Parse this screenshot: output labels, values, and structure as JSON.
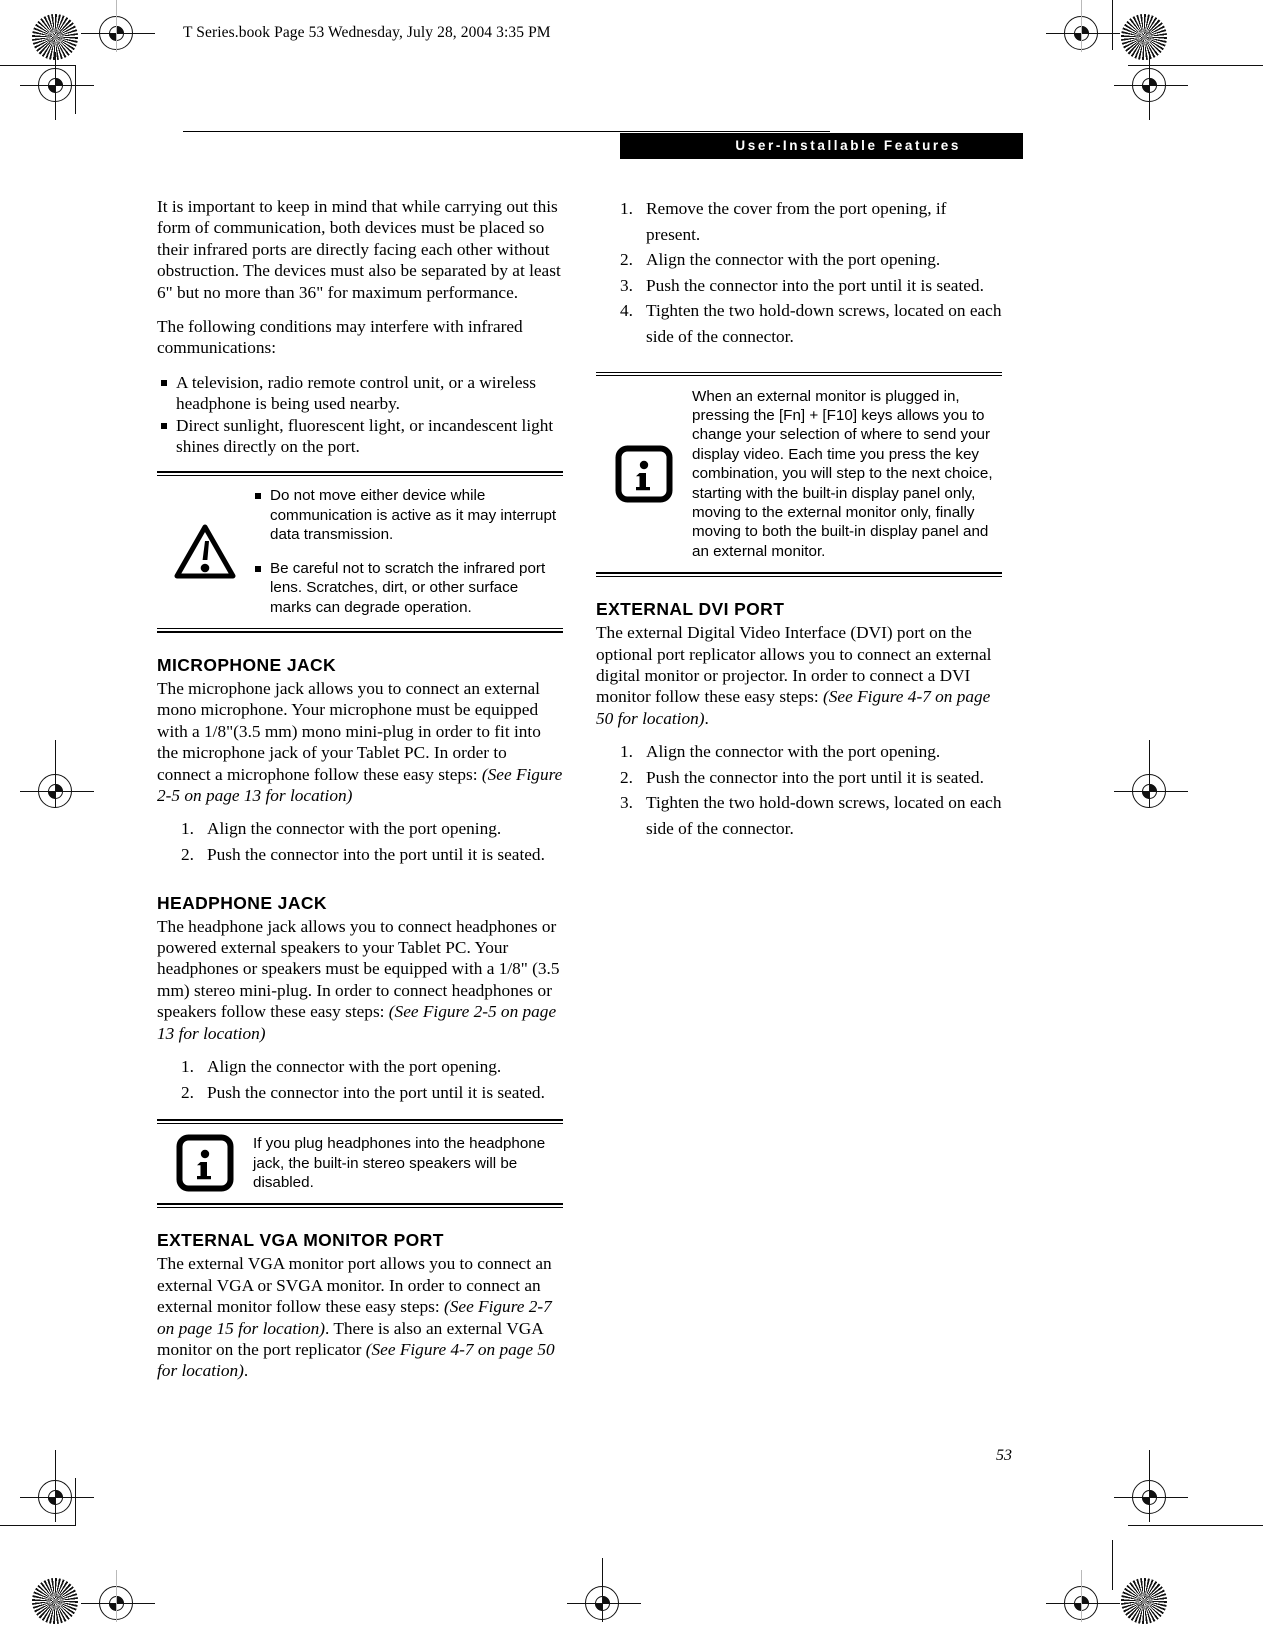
{
  "print_marks": {
    "file_stamp": "T Series.book  Page 53  Wednesday, July 28, 2004  3:35 PM",
    "star_target_name": "star-target",
    "registration_name": "registration-mark"
  },
  "header": {
    "title": "User-Installable Features"
  },
  "page": {
    "number": "53"
  },
  "left_column": {
    "intro_paragraph": "It is important to keep in mind that while carrying out this form of communication, both devices must be placed so their infrared ports are directly facing each other without obstruction. The devices must also be separated by at least 6\" but no more than 36\" for maximum performance.",
    "conditions_lead": "The following conditions may interfere with infrared communications:",
    "conditions": [
      "A television, radio remote control unit, or a wireless headphone is being used nearby.",
      "Direct sunlight, fluorescent light, or incandescent light shines directly on the port."
    ],
    "warning_callout": {
      "icon": "warning-triangle-icon",
      "items": [
        "Do not move either device while communication is active as it may interrupt data transmission.",
        "Be careful not to scratch the infrared port lens. Scratches, dirt, or other surface marks can degrade operation."
      ]
    },
    "microphone_jack": {
      "heading": "MICROPHONE JACK",
      "body_plain": "The microphone jack allows you to connect an external mono microphone. Your microphone must be equipped with a 1/8\"(3.5 mm) mono mini-plug in order to fit into the microphone jack of your Tablet PC. In order to connect a microphone follow these easy steps: ",
      "body_italic": "(See Figure 2-5 on page 13 for location)",
      "steps": [
        "Align the connector with the port opening.",
        "Push the connector into the port until it is seated."
      ]
    },
    "headphone_jack": {
      "heading": "HEADPHONE JACK",
      "body_plain": "The headphone jack allows you to connect headphones or powered external speakers to your Tablet PC. Your headphones or speakers must be equipped with a 1/8\" (3.5 mm) stereo mini-plug. In order to connect headphones or speakers follow these easy steps: ",
      "body_italic": "(See Figure 2-5 on page 13 for location)",
      "steps": [
        "Align the connector with the port opening.",
        "Push the connector into the port until it is seated."
      ],
      "info_callout": {
        "icon": "info-icon",
        "text": "If you plug headphones into the headphone jack, the built-in stereo speakers will be disabled."
      }
    },
    "vga_port": {
      "heading": "EXTERNAL VGA MONITOR PORT",
      "body_part1": "The external VGA monitor port allows you to connect an external VGA or SVGA monitor. In order to connect an external monitor follow these easy steps: ",
      "body_italic1": "(See Figure 2-7 on page 15 for location)",
      "body_part2": ". There is also an external VGA monitor on the port replicator ",
      "body_italic2": "(See Figure 4-7 on page 50 for location)",
      "body_part3": "."
    }
  },
  "right_column": {
    "vga_steps": [
      "Remove the cover from the port opening, if present.",
      "Align the connector with the port opening.",
      "Push the connector into the port until it is seated.",
      "Tighten the two hold-down screws, located on each side of the connector."
    ],
    "monitor_info_callout": {
      "icon": "info-icon",
      "text": "When an external monitor is plugged in, pressing the [Fn] + [F10] keys allows you to change your selection of where to send your display video. Each time you press the key combination, you will step to the next choice, starting with the built-in display panel only, moving to the external monitor only, finally moving to both the built-in display panel and an external monitor."
    },
    "dvi_port": {
      "heading": "EXTERNAL DVI PORT",
      "body_plain": "The external Digital Video Interface (DVI) port on the optional port replicator allows you to connect an external digital monitor or projector. In order to connect a DVI monitor follow these easy steps: ",
      "body_italic": "(See Figure 4-7 on page 50 for location)",
      "body_tail": ".",
      "steps": [
        "Align the connector with the port opening.",
        "Push the connector into the port until it is seated.",
        "Tighten the two hold-down screws, located on each side of the connector."
      ]
    }
  },
  "colors": {
    "ink": "#000000",
    "paper": "#ffffff",
    "header_bar": "#000000",
    "header_text": "#ffffff"
  }
}
